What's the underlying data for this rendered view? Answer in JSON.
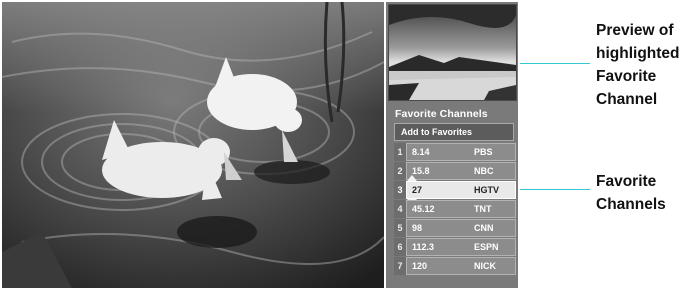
{
  "video": {
    "description_icon": "ducks-in-pond-video"
  },
  "panel": {
    "title": "Favorite Channels",
    "add_button": "Add to Favorites",
    "selected_index": 2,
    "channels": [
      {
        "index": "1",
        "channel": "8.14",
        "name": "PBS"
      },
      {
        "index": "2",
        "channel": "15.8",
        "name": "NBC"
      },
      {
        "index": "3",
        "channel": "27",
        "name": "HGTV"
      },
      {
        "index": "4",
        "channel": "45.12",
        "name": "TNT"
      },
      {
        "index": "5",
        "channel": "98",
        "name": "CNN"
      },
      {
        "index": "6",
        "channel": "112.3",
        "name": "ESPN"
      },
      {
        "index": "7",
        "channel": "120",
        "name": "NICK"
      }
    ]
  },
  "callouts": {
    "preview": [
      "Preview of",
      "highlighted",
      "Favorite",
      "Channel"
    ],
    "favorites": [
      "Favorite",
      "Channels"
    ]
  },
  "colors": {
    "callout_line": "#32c8d2",
    "panel_bg": "#7a7a7a",
    "selected_row": "#e9e9e9"
  }
}
